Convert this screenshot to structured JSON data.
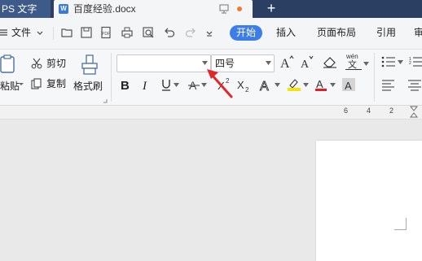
{
  "tabs": {
    "app_label": "PS 文字",
    "doc_icon_letter": "W",
    "doc_title": "百度经验.docx",
    "new_tab_symbol": "+"
  },
  "menu": {
    "file_label": "文件",
    "items": [
      "开始",
      "插入",
      "页面布局",
      "引用",
      "审"
    ]
  },
  "ribbon": {
    "cut_label": "剪切",
    "paste_label": "粘贴",
    "copy_label": "复制",
    "format_painter_label": "格式刷",
    "font_name_value": "",
    "font_size_value": "四号",
    "wen_label": "wén",
    "wen_char": "文"
  },
  "ruler": {
    "numbers": [
      "6",
      "4",
      "2"
    ]
  },
  "colors": {
    "title_bar": "#2b3f63",
    "accent": "#3d7de8",
    "arrow": "#e3262a",
    "highlight_yellow": "#f5e10c",
    "font_color_red": "#e02020"
  }
}
